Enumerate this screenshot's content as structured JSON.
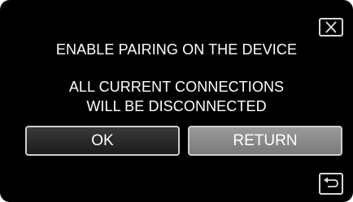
{
  "dialog": {
    "close_icon": "close-icon",
    "message_line_1": "ENABLE PAIRING ON THE DEVICE",
    "message_line_2": "ALL CURRENT CONNECTIONS",
    "message_line_3": "WILL BE DISCONNECTED",
    "ok_label": "OK",
    "return_label": "RETURN",
    "back_icon": "return-arrow-icon"
  },
  "colors": {
    "background": "#000000",
    "text": "#ffffff",
    "ok_button": "#2a2a2a",
    "return_button": "#8a8a8a",
    "border": "#cfcfcf"
  }
}
